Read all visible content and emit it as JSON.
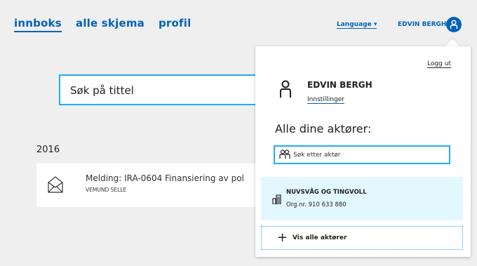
{
  "nav": {
    "innboks": "innboks",
    "alle_skjema": "alle skjema",
    "profil": "profil"
  },
  "header": {
    "language": "Language ▾",
    "user_name": "EDVIN BERGH"
  },
  "search": {
    "placeholder": "Søk på tittel"
  },
  "inbox": {
    "year": "2016",
    "message": {
      "title": "Melding: IRA-0604 Finansiering av pol",
      "sender": "VEMUND SELLE"
    }
  },
  "panel": {
    "logout": "Logg ut",
    "name": "EDVIN BERGH",
    "settings": "Innstillinger",
    "actors_title": "Alle dine aktører:",
    "actor_search_placeholder": "Søk etter aktør",
    "org_name": "NUVSVÅG OG TINGVOLL",
    "org_number": "Org.nr. 910 633 880",
    "show_all": "Vis alle aktører"
  },
  "colors": {
    "accent": "#0062ba",
    "focus": "#1eaef7",
    "org_bg": "#e3f7ff"
  }
}
